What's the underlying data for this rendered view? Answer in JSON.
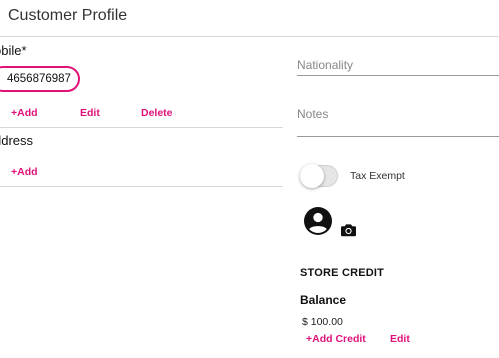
{
  "header": {
    "title": "Customer Profile"
  },
  "mobile": {
    "label": "obile*",
    "phone": "4656876987",
    "actions": {
      "add": "+Add",
      "edit": "Edit",
      "delete": "Delete"
    }
  },
  "address": {
    "label": "ddress",
    "add": "+Add"
  },
  "fields": {
    "nationality_placeholder": "Nationality",
    "notes_placeholder": "Notes"
  },
  "tax_exempt": {
    "label": "Tax Exempt",
    "enabled": false
  },
  "icons": {
    "avatar": "account-circle-icon",
    "camera": "camera-icon"
  },
  "store_credit": {
    "title": "STORE CREDIT",
    "balance_label": "Balance",
    "balance_value": "$ 100.00",
    "add_credit": "+Add Credit",
    "edit": "Edit"
  },
  "colors": {
    "accent": "#e0127a"
  }
}
